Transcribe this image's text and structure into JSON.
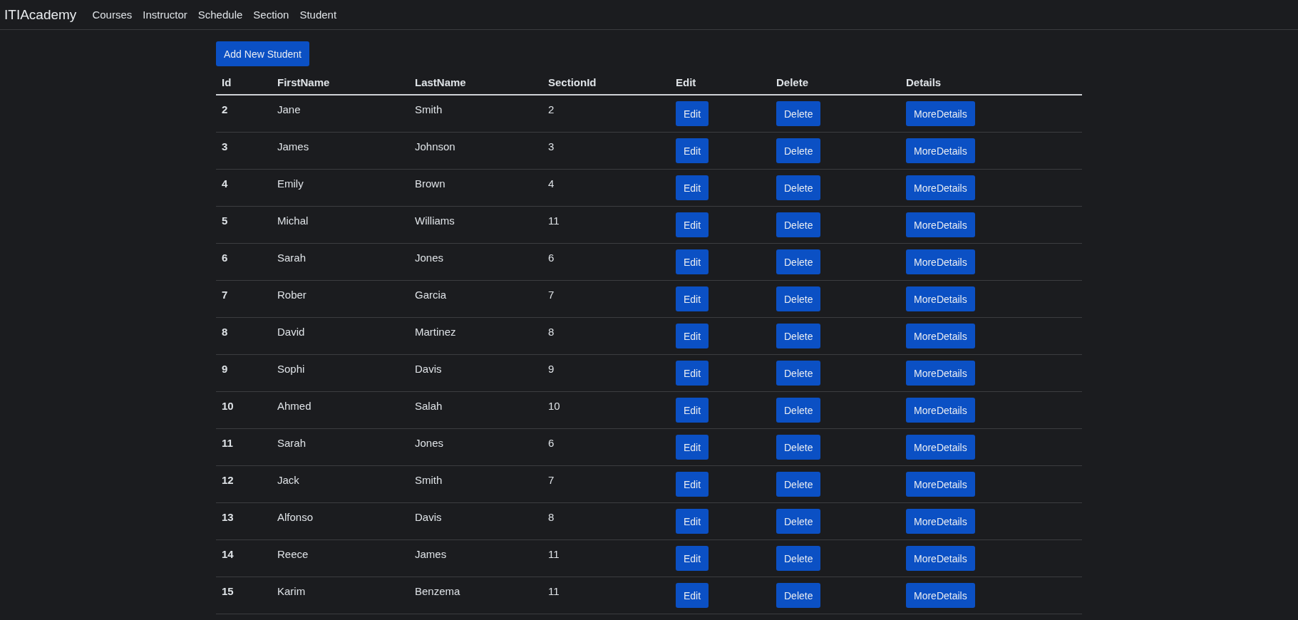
{
  "navbar": {
    "brand": "ITIAcademy",
    "links": [
      "Courses",
      "Instructor",
      "Schedule",
      "Section",
      "Student"
    ]
  },
  "add_button": "Add New Student",
  "table": {
    "columns": [
      "Id",
      "FirstName",
      "LastName",
      "SectionId",
      "Edit",
      "Delete",
      "Details"
    ],
    "rows": [
      {
        "id": "2",
        "first_name": "Jane",
        "last_name": "Smith",
        "section_id": "2",
        "edit": "Edit",
        "delete": "Delete",
        "details": "MoreDetails"
      },
      {
        "id": "3",
        "first_name": "James",
        "last_name": "Johnson",
        "section_id": "3",
        "edit": "Edit",
        "delete": "Delete",
        "details": "MoreDetails"
      },
      {
        "id": "4",
        "first_name": "Emily",
        "last_name": "Brown",
        "section_id": "4",
        "edit": "Edit",
        "delete": "Delete",
        "details": "MoreDetails"
      },
      {
        "id": "5",
        "first_name": "Michal",
        "last_name": "Williams",
        "section_id": "11",
        "edit": "Edit",
        "delete": "Delete",
        "details": "MoreDetails"
      },
      {
        "id": "6",
        "first_name": "Sarah",
        "last_name": "Jones",
        "section_id": "6",
        "edit": "Edit",
        "delete": "Delete",
        "details": "MoreDetails"
      },
      {
        "id": "7",
        "first_name": "Rober",
        "last_name": "Garcia",
        "section_id": "7",
        "edit": "Edit",
        "delete": "Delete",
        "details": "MoreDetails"
      },
      {
        "id": "8",
        "first_name": "David",
        "last_name": "Martinez",
        "section_id": "8",
        "edit": "Edit",
        "delete": "Delete",
        "details": "MoreDetails"
      },
      {
        "id": "9",
        "first_name": "Sophi",
        "last_name": "Davis",
        "section_id": "9",
        "edit": "Edit",
        "delete": "Delete",
        "details": "MoreDetails"
      },
      {
        "id": "10",
        "first_name": "Ahmed",
        "last_name": "Salah",
        "section_id": "10",
        "edit": "Edit",
        "delete": "Delete",
        "details": "MoreDetails"
      },
      {
        "id": "11",
        "first_name": "Sarah",
        "last_name": "Jones",
        "section_id": "6",
        "edit": "Edit",
        "delete": "Delete",
        "details": "MoreDetails"
      },
      {
        "id": "12",
        "first_name": "Jack",
        "last_name": "Smith",
        "section_id": "7",
        "edit": "Edit",
        "delete": "Delete",
        "details": "MoreDetails"
      },
      {
        "id": "13",
        "first_name": "Alfonso",
        "last_name": "Davis",
        "section_id": "8",
        "edit": "Edit",
        "delete": "Delete",
        "details": "MoreDetails"
      },
      {
        "id": "14",
        "first_name": "Reece",
        "last_name": "James",
        "section_id": "11",
        "edit": "Edit",
        "delete": "Delete",
        "details": "MoreDetails"
      },
      {
        "id": "15",
        "first_name": "Karim",
        "last_name": "Benzema",
        "section_id": "11",
        "edit": "Edit",
        "delete": "Delete",
        "details": "MoreDetails"
      }
    ]
  }
}
